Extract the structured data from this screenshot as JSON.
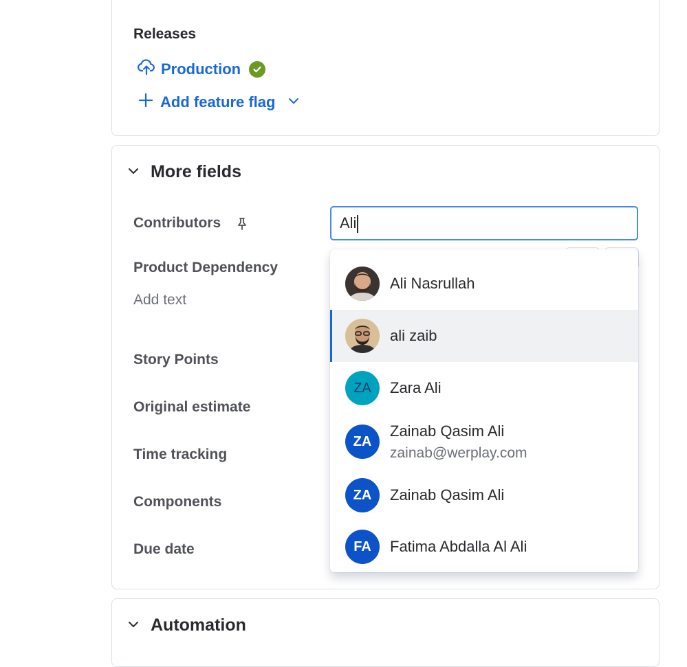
{
  "releases": {
    "title": "Releases",
    "production_label": "Production",
    "add_flag_label": "Add feature flag"
  },
  "more_fields": {
    "title": "More fields",
    "contributors_label": "Contributors",
    "contributors_search_value": "Ali",
    "product_dependency_label": "Product Dependency",
    "product_dependency_placeholder": "Add text",
    "story_points_label": "Story Points",
    "original_estimate_label": "Original estimate",
    "time_tracking_label": "Time tracking",
    "components_label": "Components",
    "due_date_label": "Due date"
  },
  "automation": {
    "title": "Automation"
  },
  "suggestions": [
    {
      "name": "Ali Nasrullah",
      "avatar_type": "photo",
      "avatar_icon": "user-photo"
    },
    {
      "name": "ali zaib",
      "avatar_type": "photo",
      "avatar_icon": "user-photo",
      "selected": true
    },
    {
      "name": "Zara Ali",
      "initials": "ZA",
      "avatar_color": "#00a3bf",
      "initials_color": "#1d3a6b"
    },
    {
      "name": "Zainab Qasim Ali",
      "email": "zainab@werplay.com",
      "initials": "ZA",
      "avatar_color": "#0c52c9"
    },
    {
      "name": "Zainab Qasim Ali",
      "initials": "ZA",
      "avatar_color": "#0c52c9"
    },
    {
      "name": "Fatima Abdalla Al Ali",
      "initials": "FA",
      "avatar_color": "#0c52c9"
    }
  ],
  "colors": {
    "link": "#1868db",
    "success": "#6a9a23",
    "focus": "#4688ec",
    "selected_bg": "#f0f1f2"
  }
}
